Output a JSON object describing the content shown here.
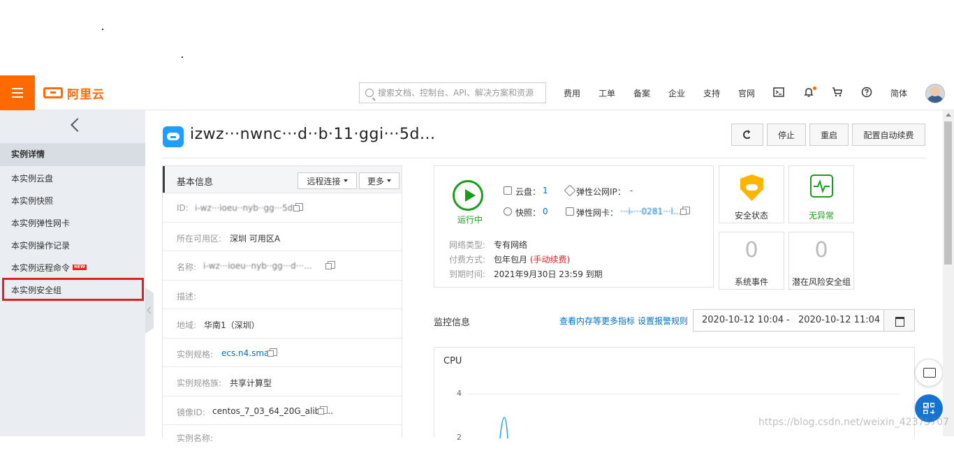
{
  "header": {
    "logo_text": "阿里云",
    "search_placeholder": "搜索文档、控制台、API、解决方案和资源",
    "nav": {
      "fee": "费用",
      "ticket": "工单",
      "icp": "备案",
      "enterprise": "企业",
      "support": "支持",
      "official": "官网",
      "lang": "简体"
    }
  },
  "sidebar": {
    "section_title": "实例详情",
    "items": [
      "本实例云盘",
      "本实例快照",
      "本实例弹性网卡",
      "本实例操作记录",
      "本实例远程命令",
      "本实例安全组"
    ],
    "new_badge": "NEW"
  },
  "instance": {
    "title": "izwz···nwnc···d··b·11·ggi···5d...",
    "buttons": {
      "stop": "停止",
      "restart": "重启",
      "auto_renew": "配置自动续费"
    }
  },
  "basic_info": {
    "title": "基本信息",
    "remote_btn": "远程连接",
    "more_btn": "更多",
    "rows": [
      {
        "label": "ID:",
        "value": "i-wz···ioeu··nyb··gg···5d"
      },
      {
        "label": "所在可用区:",
        "value": "深圳 可用区A"
      },
      {
        "label": "名称:",
        "value": "i-wz···ioeu··nyb··gg···d···..."
      },
      {
        "label": "描述:",
        "value": ""
      },
      {
        "label": "地域:",
        "value": "华南1（深圳）"
      },
      {
        "label": "实例规格:",
        "value": "ecs.n4.small"
      },
      {
        "label": "实例规格族:",
        "value": "共享计算型"
      },
      {
        "label": "镜像ID:",
        "value": "centos_7_03_64_20G_aliba..."
      },
      {
        "label": "实例名称:",
        "value": ""
      }
    ]
  },
  "status": {
    "state": "运行中",
    "cloud_disk_label": "云盘：",
    "cloud_disk_count": "1",
    "snapshot_label": "快照：",
    "snapshot_count": "0",
    "eip_label": "弹性公网IP：",
    "eip_value": "-",
    "eni_label": "弹性网卡：",
    "eni_value": "···i-···0281···l...",
    "network_type_label": "网络类型:",
    "network_type": "专有网络",
    "billing_label": "付费方式:",
    "billing": "包年包月",
    "renew_hint": "(手动续费)",
    "expire_label": "到期时间:",
    "expire": "2021年9月30日 23:59 到期"
  },
  "tiles": {
    "security_status": "安全状态",
    "no_anomaly": "无异常",
    "system_events_count": "0",
    "system_events": "系统事件",
    "risk_groups_count": "0",
    "risk_groups": "潜在风险安全组"
  },
  "monitor": {
    "title": "监控信息",
    "link_more": "查看内存等更多指标",
    "link_alarm": "设置报警规则",
    "start": "2020-10-12 10:04",
    "separator": "-",
    "end": "2020-10-12 11:04",
    "chart_title": "CPU",
    "y_ticks": [
      "4",
      "2"
    ]
  },
  "watermark": "https://blog.csdn.net/weixin_42375707"
}
